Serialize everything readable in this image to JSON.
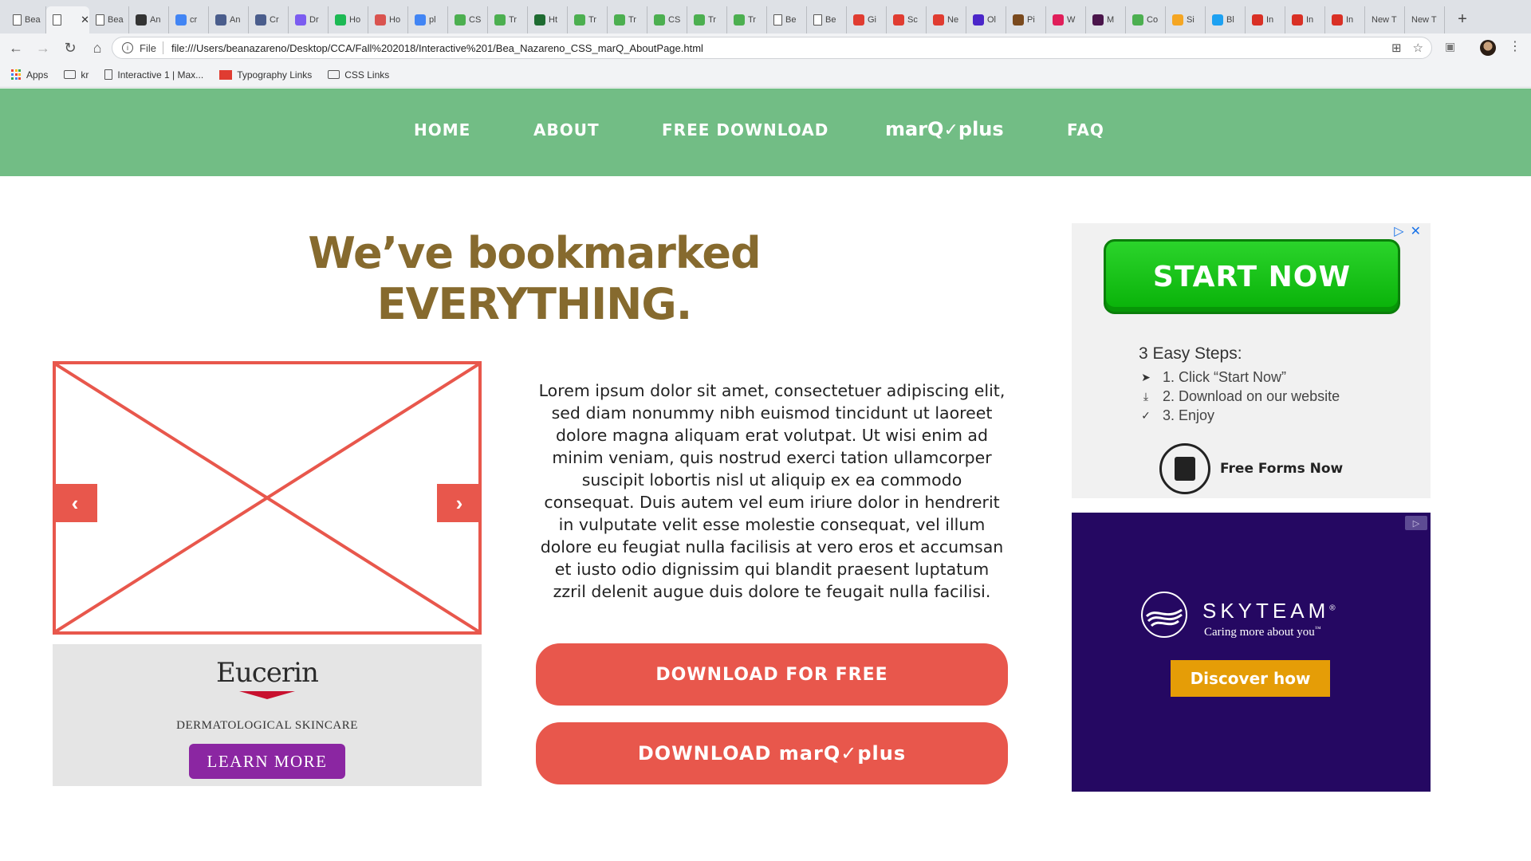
{
  "browser": {
    "tabs": [
      {
        "title": "Bea",
        "fav": "page-icon",
        "color": "#ffffff"
      },
      {
        "title": "",
        "fav": "page-icon",
        "color": "#ffffff",
        "active": true
      },
      {
        "title": "Bea",
        "fav": "page-icon",
        "color": "#ffffff"
      },
      {
        "title": "An",
        "fav": "app-icon",
        "color": "#333333"
      },
      {
        "title": "cr",
        "fav": "google-icon",
        "color": "#4285f4"
      },
      {
        "title": "An",
        "fav": "app-icon",
        "color": "#4a5d8c"
      },
      {
        "title": "Cr",
        "fav": "app-icon",
        "color": "#4a5d8c"
      },
      {
        "title": "Dr",
        "fav": "heart-icon",
        "color": "#7b5cf0"
      },
      {
        "title": "Ho",
        "fav": "app-icon",
        "color": "#1db954"
      },
      {
        "title": "Ho",
        "fav": "app-icon",
        "color": "#d9534f"
      },
      {
        "title": "pl",
        "fav": "google-icon",
        "color": "#4285f4"
      },
      {
        "title": "CS",
        "fav": "w3-icon",
        "color": "#4caf50"
      },
      {
        "title": "Tr",
        "fav": "w3-icon",
        "color": "#4caf50"
      },
      {
        "title": "Ht",
        "fav": "app-icon",
        "color": "#1e6b31"
      },
      {
        "title": "Tr",
        "fav": "w3-icon",
        "color": "#4caf50"
      },
      {
        "title": "Tr",
        "fav": "w3-icon",
        "color": "#4caf50"
      },
      {
        "title": "CS",
        "fav": "w3-icon",
        "color": "#4caf50"
      },
      {
        "title": "Tr",
        "fav": "w3-icon",
        "color": "#4caf50"
      },
      {
        "title": "Tr",
        "fav": "w3-icon",
        "color": "#4caf50"
      },
      {
        "title": "Be",
        "fav": "page-icon",
        "color": "#ffffff"
      },
      {
        "title": "Be",
        "fav": "page-icon",
        "color": "#ffffff"
      },
      {
        "title": "Gi",
        "fav": "app-icon",
        "color": "#e03c31"
      },
      {
        "title": "Sc",
        "fav": "adobe-icon",
        "color": "#e03c31"
      },
      {
        "title": "Ne",
        "fav": "adobe-icon",
        "color": "#e03c31"
      },
      {
        "title": "Ol",
        "fav": "app-icon",
        "color": "#4b26c9"
      },
      {
        "title": "Pi",
        "fav": "app-icon",
        "color": "#7a4a1e"
      },
      {
        "title": "W",
        "fav": "slack-icon",
        "color": "#e01e5a"
      },
      {
        "title": "M",
        "fav": "slack-icon",
        "color": "#4a154b"
      },
      {
        "title": "Co",
        "fav": "w3-icon",
        "color": "#4caf50"
      },
      {
        "title": "Si",
        "fav": "star-icon",
        "color": "#f5a623"
      },
      {
        "title": "Bl",
        "fav": "twitter-icon",
        "color": "#1da1f2"
      },
      {
        "title": "In",
        "fav": "gmail-icon",
        "color": "#d93025"
      },
      {
        "title": "In",
        "fav": "gmail-icon",
        "color": "#d93025"
      },
      {
        "title": "In",
        "fav": "gmail-icon",
        "color": "#d93025"
      },
      {
        "title": "New T",
        "fav": "none",
        "color": "#dee1e6"
      },
      {
        "title": "New T",
        "fav": "none",
        "color": "#dee1e6"
      }
    ],
    "url_prefix": "File",
    "url": "file:///Users/beanazareno/Desktop/CCA/Fall%202018/Interactive%201/Bea_Nazareno_CSS_marQ_AboutPage.html",
    "bookmarks": [
      {
        "label": "Apps",
        "icon": "apps-icon"
      },
      {
        "label": "kr",
        "icon": "folder-icon"
      },
      {
        "label": "Interactive 1 | Max...",
        "icon": "page-icon"
      },
      {
        "label": "Typography Links",
        "icon": "red-doc-icon"
      },
      {
        "label": "CSS Links",
        "icon": "folder-icon"
      }
    ]
  },
  "site": {
    "nav": {
      "home": "HOME",
      "about": "ABOUT",
      "free_download": "FREE DOWNLOAD",
      "plus_brand": "marQ",
      "plus_suffix": "plus",
      "faq": "FAQ"
    },
    "headline_line1": "We’ve bookmarked",
    "headline_line2": "EVERYTHING.",
    "body": "Lorem ipsum dolor sit amet, consectetuer adipiscing elit, sed diam nonummy nibh euismod tincidunt ut laoreet dolore magna aliquam erat volutpat. Ut wisi enim ad minim veniam, quis nostrud exerci tation ullamcorper suscipit lobortis nisl ut aliquip ex ea commodo consequat. Duis autem vel eum iriure dolor in hendrerit in vulputate velit esse molestie consequat, vel illum dolore eu feugiat nulla facilisis at vero eros et accumsan et iusto odio dignissim qui blandit praesent luptatum zzril delenit augue duis dolore te feugait nulla facilisi.",
    "cta_free": "DOWNLOAD FOR FREE",
    "cta_plus_prefix": "DOWNLOAD",
    "cta_plus_brand": "marQ",
    "cta_plus_suffix": "plus",
    "slider_prev": "‹",
    "slider_next": "›",
    "colors": {
      "nav": "#72bd85",
      "accent": "#e8574c",
      "headline": "#866a2e"
    }
  },
  "ads": {
    "eucerin": {
      "logo": "Eucerin",
      "tagline": "DERMATOLOGICAL SKINCARE",
      "button": "LEARN MORE"
    },
    "start": {
      "button": "START NOW",
      "steps_title": "3 Easy Steps:",
      "steps": [
        "1. Click “Start Now”",
        "2. Download on our website",
        "3. Enjoy"
      ],
      "forms": "Free Forms Now"
    },
    "skyteam": {
      "name": "SKYTEAM",
      "reg": "®",
      "tagline": "Caring more about you",
      "tm": "™",
      "button": "Discover how"
    }
  }
}
